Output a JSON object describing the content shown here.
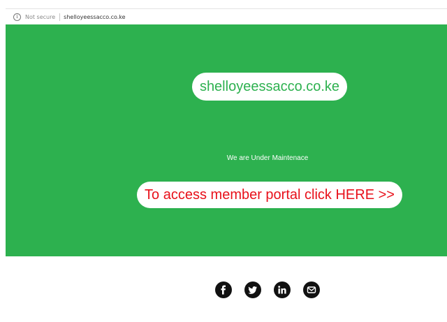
{
  "browser": {
    "security_label": "Not secure",
    "url": "shelloyeessacco.co.ke"
  },
  "hero": {
    "site_name": "shelloyeessacco.co.ke",
    "maintenance_text": "We are Under Maintenace",
    "portal_link": "To access member portal click HERE >>"
  },
  "footer": {
    "social_icons": [
      "facebook-icon",
      "twitter-icon",
      "linkedin-icon",
      "email-icon"
    ]
  },
  "colors": {
    "hero_green": "#2db14f",
    "link_red": "#e8101a"
  }
}
